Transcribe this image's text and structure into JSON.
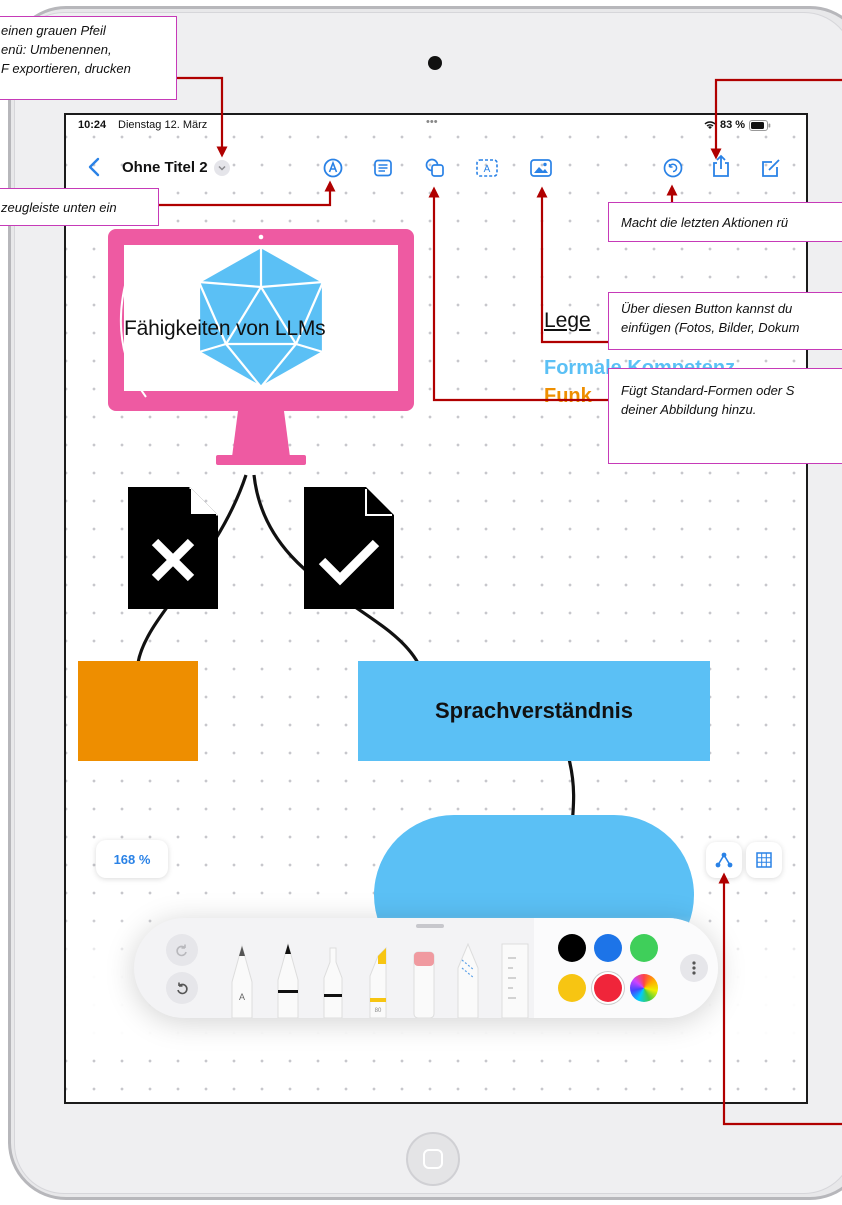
{
  "status_bar": {
    "time": "10:24",
    "date": "Dienstag 12. März",
    "dots": "•••",
    "battery": "83 %"
  },
  "nav": {
    "title": "Ohne Titel 2"
  },
  "canvas": {
    "monitor_label": "Fähigkeiten von LLMs",
    "legend_title": "Lege",
    "legend_item_1": "Formale Kompetenz",
    "legend_item_2": "Funk",
    "box_label": "Sprachverständnis"
  },
  "zoom": {
    "label": "168 %"
  },
  "callouts": {
    "top_left": [
      "einen grauen Pfeil",
      "enü: Umbenennen,",
      "F exportieren, drucken"
    ],
    "toolbar": "zeugleiste unten ein",
    "undo": "Macht die letzten Aktionen rü",
    "media": [
      "Über diesen Button kannst du",
      "einfügen (Fotos, Bilder, Dokum"
    ],
    "shapes": [
      "Fügt Standard-Formen oder S",
      "deiner Abbildung hinzu."
    ]
  },
  "colors": {
    "accent": "#2a82e6",
    "monitor_pink": "#ee5aa2",
    "shape_blue": "#5bc0f5",
    "orange": "#ee8e00",
    "callout_border": "#c63ab8",
    "arrow_red": "#b00000",
    "palette": [
      "#000000",
      "#1d74e8",
      "#3fcf5a",
      "#f7c512",
      "#f0253a",
      "spectrum"
    ]
  },
  "icons": [
    "back-chevron-icon",
    "title-chevron-down-icon",
    "markup-pen-icon",
    "list-icon",
    "shapes-icon",
    "textbox-icon",
    "media-icon",
    "undo-icon",
    "share-icon",
    "compose-icon",
    "redo-icon",
    "undo-tool-icon",
    "more-icon",
    "selection-icon",
    "grid-icon"
  ]
}
